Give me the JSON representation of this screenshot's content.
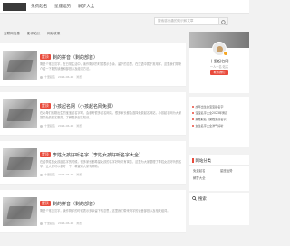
{
  "nav": {
    "items": [
      "免费起名",
      "星座运势",
      "解梦大全"
    ]
  },
  "search": {
    "placeholder": "搜索感兴趣的知识和文章"
  },
  "subnav": {
    "items": [
      "互联网信息",
      "影评站长",
      "网站收录"
    ]
  },
  "posts": [
    {
      "tag": "置顶",
      "title": "剩的拼音（剩的部首）",
      "excerpt": "剩是个常见汉字，在日常生活中，读作剩字的时候表示多余、留下的意思，在汉语中属于常用字，这里我们带来介绍一下剩的读音和部首以及组词方法。",
      "author": "十里起名",
      "date": "2024-06-20",
      "views": "浏览"
    },
    {
      "tag": "置顶",
      "title": "小孩起名网（小孩起名网免费）",
      "excerpt": "在父母们给刚出生的宝宝起名字时，会参考很多起名网站，很多家长都会选择免费起名网站，小孩起名网为大家提供免费起名服务，了解更多起名知识。",
      "author": "十里起名",
      "date": "2024-06-20",
      "views": "浏览"
    },
    {
      "tag": "置顶",
      "title": "李姓女孩好听名字（李姓女孩好听名字大全）",
      "excerpt": "在给李姓的女孩起名字的时候，很多家长都希望女孩的名字好听又有寓意，这里为大家整理了李姓女孩好听的名字，让大家可以参考一下，希望对大家有帮助。",
      "author": "十里起名",
      "date": "2024-06-20",
      "views": "浏览"
    },
    {
      "tag": "置顶",
      "title": "剩的拼音（剩的部首）",
      "excerpt": "剩是个常见汉字，读作剩字的时候表示多余留下的意思，这里我们带来剩字的读音部首以及相关组词。",
      "author": "十里起名",
      "date": "2024-06-20",
      "views": "浏览"
    }
  ],
  "profile": {
    "name": "十里起名网",
    "subtitle": "一人一名·站名",
    "button": "联系我们"
  },
  "news": [
    "虎年出生的宝宝起名字",
    "宝宝名字大全2023年男孩",
    "梁姓取名（梁姓女孩名字）",
    "女生名字大全洋气好听"
  ],
  "links_box": {
    "title": "网站分类",
    "items": [
      "免费起名",
      "星座运势",
      "解梦大全"
    ]
  },
  "search_box": {
    "title": "搜索"
  },
  "colors": {
    "accent": "#e94b3c",
    "background": "#f2f2f2"
  }
}
